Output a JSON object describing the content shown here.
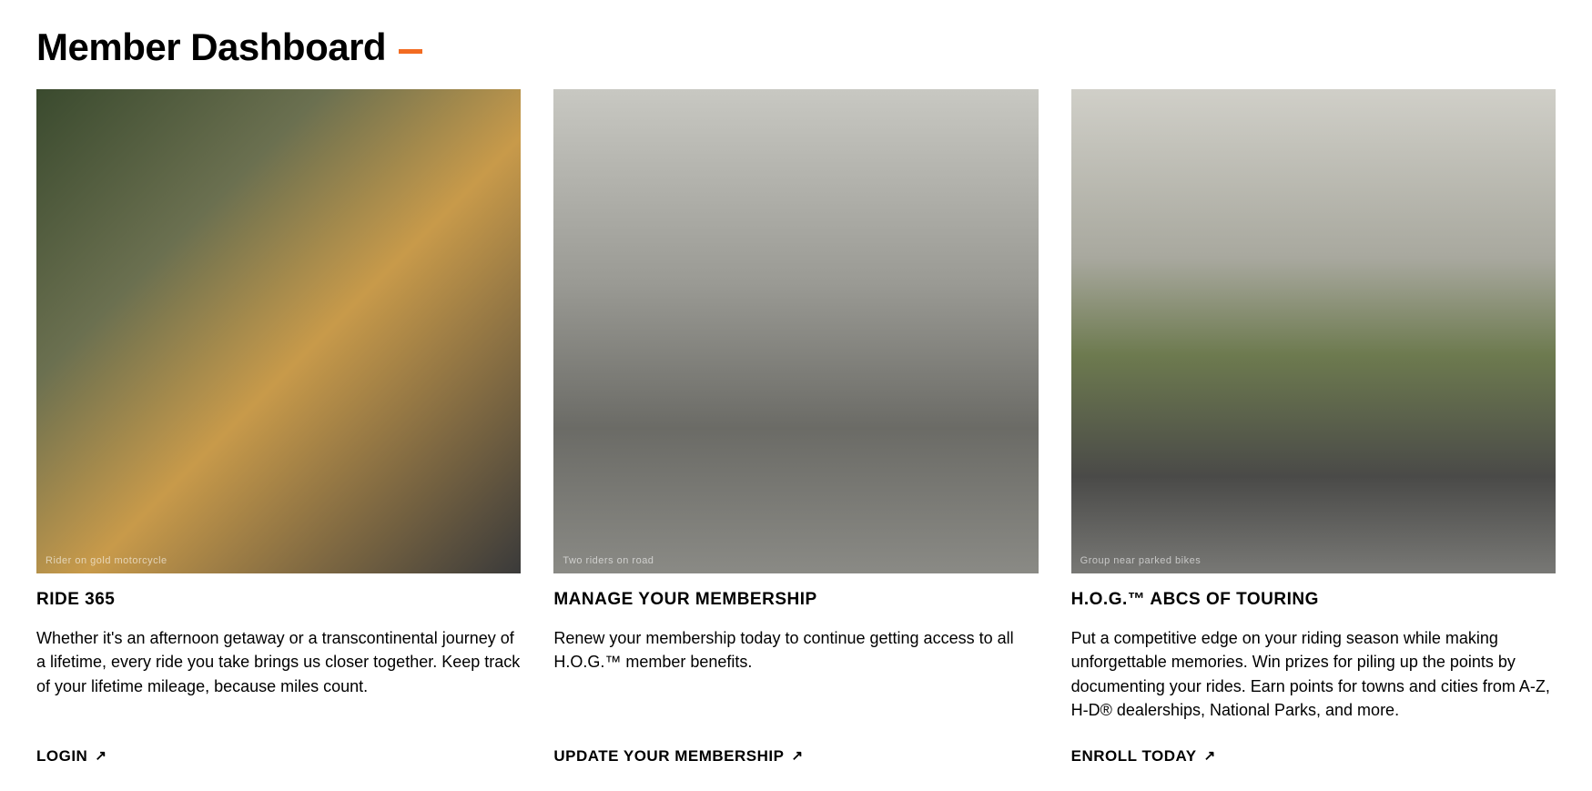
{
  "page": {
    "title": "Member Dashboard"
  },
  "cards": [
    {
      "image_alt": "Rider on gold motorcycle",
      "title": "RIDE 365",
      "description": "Whether it's an afternoon getaway or a transcontinental journey of a lifetime, every ride you take brings us closer together. Keep track of your lifetime mileage, because miles count.",
      "link_label": "LOGIN"
    },
    {
      "image_alt": "Two riders on road",
      "title": "MANAGE YOUR MEMBERSHIP",
      "description": "Renew your membership today to continue getting access to all H.O.G.™ member benefits.",
      "link_label": "UPDATE YOUR MEMBERSHIP"
    },
    {
      "image_alt": "Group near parked bikes",
      "title": "H.O.G.™ ABCS OF TOURING",
      "description": "Put a competitive edge on your riding season while making unforgettable memories. Win prizes for piling up the points by documenting your rides. Earn points for towns and cities from A-Z, H-D® dealerships, National Parks, and more.",
      "link_label": "ENROLL TODAY"
    }
  ]
}
